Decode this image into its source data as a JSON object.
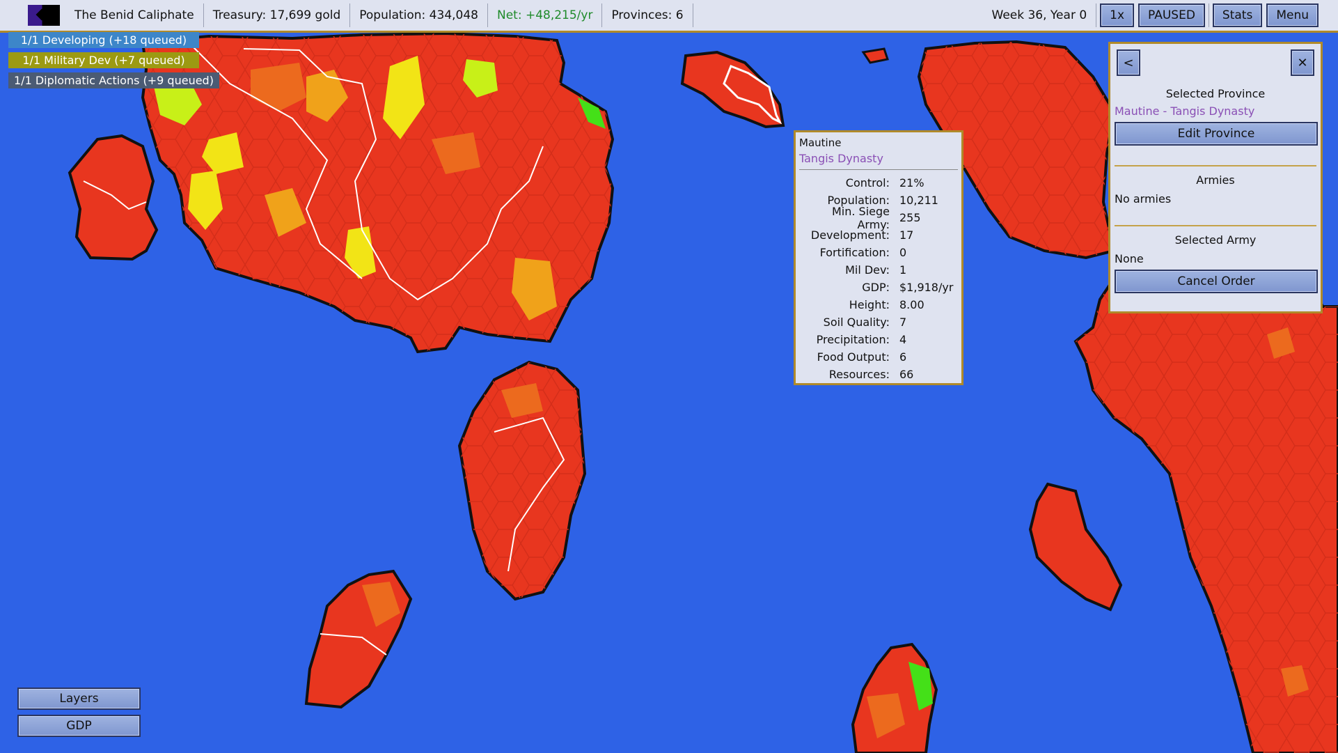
{
  "topbar": {
    "nation": "The Benid Caliphate",
    "treasury": "Treasury: 17,699 gold",
    "population": "Population: 434,048",
    "net": "Net: +48,215/yr",
    "provinces": "Provinces: 6",
    "date": "Week 36, Year 0",
    "speed_label": "1x",
    "pause_label": "PAUSED",
    "stats_label": "Stats",
    "menu_label": "Menu"
  },
  "queues": [
    "1/1 Developing (+18 queued)",
    "1/1 Military Dev (+7 queued)",
    "1/1 Diplomatic Actions (+9 queued)"
  ],
  "tooltip": {
    "title": "Mautine",
    "owner": "Tangis Dynasty",
    "rows": [
      {
        "key": "Control:",
        "value": "21%"
      },
      {
        "key": "Population:",
        "value": "10,211"
      },
      {
        "key": "Min. Siege Army:",
        "value": "255"
      },
      {
        "key": "Development:",
        "value": "17"
      },
      {
        "key": "Fortification:",
        "value": "0"
      },
      {
        "key": "Mil Dev:",
        "value": "1"
      },
      {
        "key": "GDP:",
        "value": "$1,918/yr"
      },
      {
        "key": "Height:",
        "value": "8.00"
      },
      {
        "key": "Soil Quality:",
        "value": "7"
      },
      {
        "key": "Precipitation:",
        "value": "4"
      },
      {
        "key": "Food Output:",
        "value": "6"
      },
      {
        "key": "Resources:",
        "value": "66"
      }
    ]
  },
  "panel": {
    "back_label": "<",
    "close_label": "✕",
    "selected_province_heading": "Selected Province",
    "selected_province": "Mautine - Tangis Dynasty",
    "edit_province_label": "Edit Province",
    "armies_heading": "Armies",
    "armies_value": "No armies",
    "selected_army_heading": "Selected Army",
    "selected_army_value": "None",
    "cancel_order_label": "Cancel Order"
  },
  "bottom": {
    "layers_label": "Layers",
    "gdp_label": "GDP"
  },
  "colors": {
    "ocean": "#2e62e6",
    "land_base": "#e8361f",
    "land_orange": "#ec6a1e",
    "land_amber": "#f0a21a",
    "land_yellow": "#f2e416",
    "land_lime": "#c8f018",
    "land_green": "#44e018",
    "ui_bg": "#dfe3f0",
    "ui_border": "#b08a2a"
  }
}
